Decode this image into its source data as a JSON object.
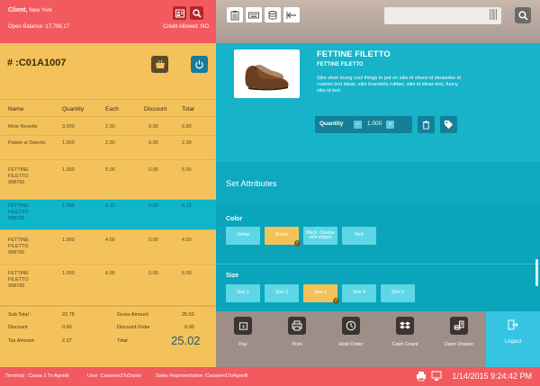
{
  "client": {
    "label": "Client,",
    "name": "New York"
  },
  "balance": "Open Balance :17,796.17",
  "credit": "Credit Allowed :NO",
  "search": {
    "placeholder": ""
  },
  "order": {
    "number": "# :C01A1007"
  },
  "table": {
    "headers": [
      "Name",
      "Quantity",
      "Each",
      "Discount",
      "Total"
    ],
    "rows": [
      {
        "name": "Mele Renette",
        "qty": "3.000",
        "each": "2.30",
        "discount": "0.00",
        "total": "6.90",
        "selected": false
      },
      {
        "name": "Patate al Selenio",
        "qty": "1.000",
        "each": "2.30",
        "discount": "0.00",
        "total": "2.30",
        "selected": false
      },
      {
        "name": "FETTINE FILETTO 998765",
        "qty": "1.000",
        "each": "5.00",
        "discount": "0.00",
        "total": "5.00",
        "selected": false
      },
      {
        "name": "FETTINE FILETTO 998765",
        "qty": "1.000",
        "each": "0.12",
        "discount": "0.00",
        "total": "0.12",
        "selected": true
      },
      {
        "name": "FETTINE FILETTO 998765",
        "qty": "1.000",
        "each": "4.00",
        "discount": "0.00",
        "total": "4.00",
        "selected": false
      },
      {
        "name": "FETTINE FILETTO 998765",
        "qty": "1.000",
        "each": "6.00",
        "discount": "0.00",
        "total": "6.00",
        "selected": false
      }
    ]
  },
  "totals": {
    "sub_total_label": "Sub Total :",
    "sub_total": "22.75",
    "gross_label": "Gross Amount",
    "gross": "25.02",
    "discount_label": "Discount",
    "discount": "0.00",
    "discount_order_label": "Discount Order",
    "discount_order": "0.00",
    "tax_label": "Tax Amount",
    "tax": "2.27",
    "total_label": "Total",
    "total": "25.02"
  },
  "product": {
    "name": "FETTINE FILETTO",
    "sub": "FETTINE FILETTO",
    "description": "Sike shoe toung cool things to put on sike id shoes id ideasnike id custom text ideas, sike bracelets rubber, sike id ideas text, funny sike id text",
    "quantity_label": "Quantity",
    "quantity": "1.000"
  },
  "attributes": {
    "title": "Set Attributes",
    "color_label": "Color",
    "colors": [
      "Yellow",
      "Brown",
      "Black, Orange with stripes",
      "Red"
    ],
    "selected_color": "Brown",
    "size_label": "Size",
    "sizes": [
      "Size 1",
      "Size 2",
      "Size 3",
      "Size 4",
      "Size 5"
    ],
    "selected_size": "Size 3"
  },
  "actions": {
    "pay": "Pay",
    "print": "Print",
    "hold": "Hold Order",
    "cash": "Cash Count",
    "drawer": "Open Drawer",
    "logout": "Logout"
  },
  "status": {
    "terminal": "Terminal : Cassa 1 To Agnelli",
    "user": "User :Cassiere2ToDante",
    "sales_rep": "Sales Representative :Cassiere1ToAgnelli",
    "datetime": "1/14/2015 9:24:42 PM"
  },
  "colors": {
    "red": "#f25a60",
    "yellow": "#f3c25a",
    "teal": "#16b3c9",
    "taupe": "#9d8f87"
  }
}
